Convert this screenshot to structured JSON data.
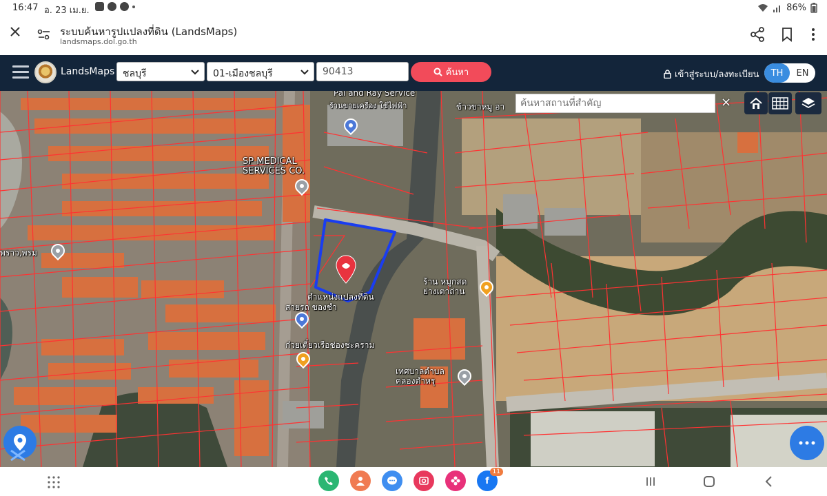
{
  "status_bar": {
    "time": "16:47",
    "date": "อ. 23 เม.ย.",
    "battery": "86%",
    "icons": [
      "gallery-icon",
      "messenger-icon",
      "chrome-icon",
      "wifi-icon",
      "signal-icon"
    ]
  },
  "browser": {
    "title": "ระบบค้นหารูปแปลงที่ดิน (LandsMaps)",
    "url": "landsmaps.dol.go.th"
  },
  "navbar": {
    "brand": "LandsMaps",
    "province": "ชลบุรี",
    "district": "01-เมืองชลบุรี",
    "parcel_number": "90413",
    "search_label": "ค้นหา",
    "login_label": "เข้าสู่ระบบ/ลงทะเบียน",
    "lang_th": "TH",
    "lang_en": "EN"
  },
  "map": {
    "place_search_placeholder": "ค้นหาสถานที่สำคัญ",
    "clear_label": "×",
    "labels": {
      "pal_service": "Pal and Ray Service",
      "repair_shop": "ร้านขายเครื่อง\nใช้ไฟฟ้า",
      "khao_kha_moo": "ข้าวขาหมู อา",
      "sp_medical": "SP MEDICAL\nSERVICES CO.",
      "phraw_phrom": "พราว,พรม",
      "parcel_location": "ตำแหน่งแปลงที่ดิน",
      "sai_rot": "สายรถ ของชำ",
      "restaurant_moo": "ร้าน หมูกสด\nย่างเตาถ่าน",
      "kuaytiaw": "ก๋วยเตี๋ยวเรือช่องชะคราม",
      "municipality": "เทศบาลตำบล\nคลองตำหรุ"
    }
  },
  "android_nav": {
    "facebook_badge": "11"
  },
  "colors": {
    "navbar_bg": "#13253a",
    "search_btn": "#f24b5a",
    "lang_active": "#3a8de0",
    "parcel_outline": "#1a3df0",
    "parcel_lines": "#ff3030",
    "fab": "#2d7be4"
  }
}
